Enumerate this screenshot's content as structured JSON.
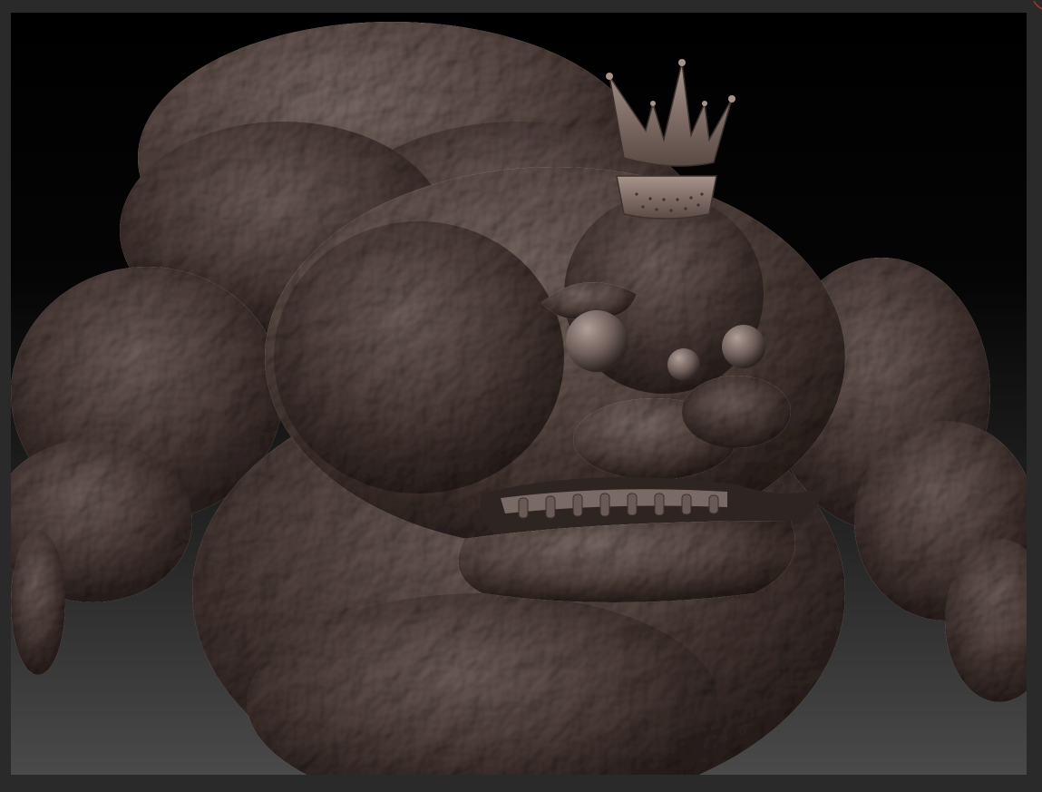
{
  "app": {
    "name": "",
    "viewport_label": ""
  },
  "scene": {
    "subject": "sculpt-model",
    "background_top": "#000000",
    "background_bottom": "#4a4a4a",
    "clay_color": "#8a7b78",
    "clay_shadow": "#3e3432",
    "clay_highlight": "#c8bdb8",
    "frame_color": "#2a2a2a",
    "accent_marker_color": "#c0392b"
  },
  "icons": {
    "corner": "corner-marker-icon",
    "crown": "crown-icon"
  }
}
